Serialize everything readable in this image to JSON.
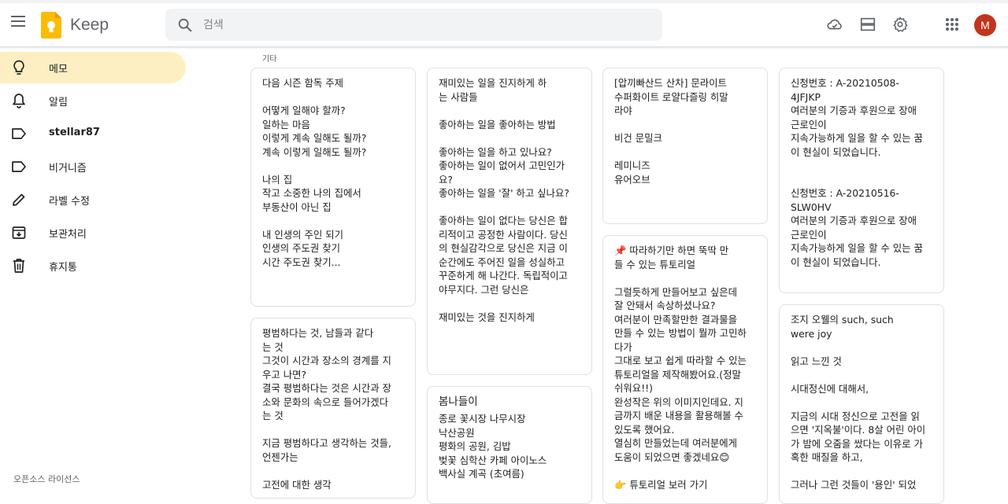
{
  "app": {
    "name": "Keep"
  },
  "search": {
    "placeholder": "검색"
  },
  "header": {
    "icons": [
      "cloud-done-icon",
      "list-view-icon",
      "settings-icon",
      "apps-grid-icon"
    ],
    "avatar_initial": "M",
    "avatar_color": "#c1351d"
  },
  "sidebar": {
    "items": [
      {
        "label": "메모",
        "icon": "lightbulb-icon",
        "active": true
      },
      {
        "label": "알림",
        "icon": "bell-icon"
      },
      {
        "label": "stellar87",
        "icon": "label-icon"
      },
      {
        "label": "비거니즘",
        "icon": "label-icon"
      },
      {
        "label": "라벨 수정",
        "icon": "pencil-icon"
      },
      {
        "label": "보관처리",
        "icon": "archive-icon"
      },
      {
        "label": "휴지통",
        "icon": "trash-icon"
      }
    ],
    "footer": "오픈소스 라이선스"
  },
  "main": {
    "section_label": "기타",
    "notes": [
      {
        "body": "다음 시즌 함독 주제\n\n어떻게 일해야 할까?\n일하는 마음\n이렇게 계속 일해도 될까?\n계속 이렇게 일해도 될까?\n\n나의 집\n작고 소중한 나의 집에서\n부동산이 아닌 집\n\n내 인생의 주인 되기\n인생의 주도권 찾기\n시간 주도권 찾기..."
      },
      {
        "body": "평범하다는 것, 남들과 같다\n는 것\n그것이 시간과 장소의 경계를 지\n우고 나면?\n결국 평범하다는 것은 시간과 장\n소와 문화의 속으로 들어가겠다\n는 것\n\n지금 평범하다고 생각하는 것들,\n언젠가는\n\n고전에 대한 생각"
      },
      {
        "body": "재미있는 일을 진지하게 하\n는 사람들\n\n좋아하는 일을 좋아하는 방법\n\n좋아하는 일을 하고 있나요?\n좋아하는 일이 없어서 고민인가\n요?\n좋아하는 일을 '잘' 하고 싶나요?\n\n좋아하는 일이 없다는 당신은 합\n리적이고 공정한 사람이다. 당신\n의 현실감각으로 당신은 지금 이\n순간에도 주어진 일을 성실하고\n꾸준하게 해 나간다. 독립적이고\n야무지다. 그런 당신은\n\n재미있는 것을 진지하게"
      },
      {
        "title": "봄나들이",
        "body": "종로 꽃시장 나무시장\n낙산공원\n평화의 공원, 김밥\n벚꽃 심학산 카페 아이노스\n백사실 계곡 (초여름)"
      },
      {
        "body": "[압끼빠산드 산차] 문라이트\n수퍼화이트 로얄다즐링 히말\n라야\n\n비건 문밀크\n\n레미니즈\n유어오브"
      },
      {
        "body": "📌 따라하기만 하면 뚝딱 만\n들 수 있는 튜토리얼\n\n그럴듯하게 만들어보고 싶은데\n잘 안돼서 속상하셨나요?\n여러분이 만족할만한 결과물을\n만들 수 있는 방법이 뭘까 고민하\n다가\n그대로 보고 쉽게 따라할 수 있는\n튜토리얼을 제작해봤어요.(정말\n쉬워요!!)\n완성작은 위의 이미지인데요. 지\n금까지 배운 내용을 활용해볼 수\n있도록 했어요.\n열심히 만들었는데 여러분에게\n도움이 되었으면 좋겠네요😊\n\n👉 튜토리얼 보러 가기"
      },
      {
        "body": "신청번호 : A-20210508-\n4JFJKP\n여러분의 기증과 후원으로 장애\n근로인이\n지속가능하게 일을 할 수 있는 꿈\n이 현실이 되었습니다.\n\n\n신청번호 : A-20210516-SLW0HV\n여러분의 기증과 후원으로 장애\n근로인이\n지속가능하게 일을 할 수 있는 꿈\n이 현실이 되었습니다."
      },
      {
        "body": "조지 오웰의 such, such\nwere joy\n\n읽고 느낀 것\n\n시대정신에 대해서,\n\n지금의 시대 정신으로 고전을 읽\n으면 '지옥불'이다. 8살 어린 아이\n가 밤에 오줌을 쌌다는 이유로 가\n혹한 매질을 하고,\n\n그러나 그런 것들이 '용인' 되었"
      }
    ]
  }
}
